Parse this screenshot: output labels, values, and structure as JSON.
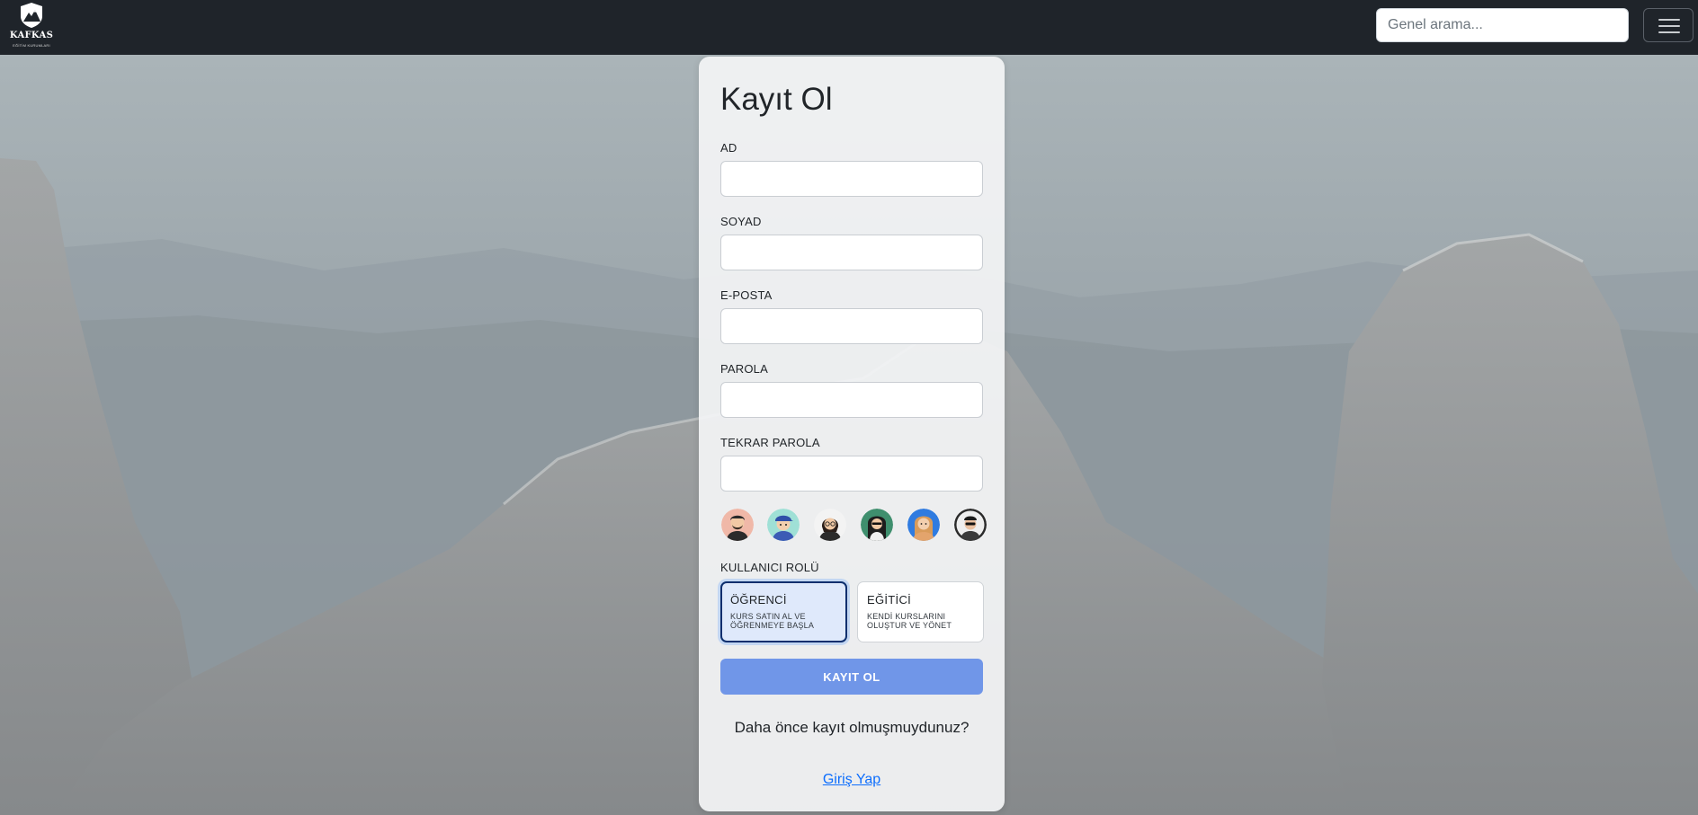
{
  "navbar": {
    "brand_name": "KAFKAS",
    "brand_subtitle": "EĞİTİM KURUMLARI",
    "search_placeholder": "Genel arama..."
  },
  "form": {
    "title": "Kayıt Ol",
    "fields": [
      {
        "label": "AD",
        "value": ""
      },
      {
        "label": "SOYAD",
        "value": ""
      },
      {
        "label": "E-POSTA",
        "value": ""
      },
      {
        "label": "PAROLA",
        "value": ""
      },
      {
        "label": "TEKRAR PAROLA",
        "value": ""
      }
    ],
    "avatars": [
      {
        "icon": "avatar-man-beard-icon",
        "bg": "#f0b8a8"
      },
      {
        "icon": "avatar-boy-cap-icon",
        "bg": "#9fe0d6"
      },
      {
        "icon": "avatar-woman-glasses-icon",
        "bg": "#f3f3f3"
      },
      {
        "icon": "avatar-woman-dark-hair-icon",
        "bg": "#3f8f6e"
      },
      {
        "icon": "avatar-woman-blonde-icon",
        "bg": "#2f7be0"
      },
      {
        "icon": "avatar-man-sunglasses-icon",
        "bg": "#2a2a2a"
      }
    ],
    "role_label": "KULLANICI ROLÜ",
    "roles": [
      {
        "title": "ÖĞRENCİ",
        "description": "KURS SATIN AL VE ÖĞRENMEYE BAŞLA",
        "selected": true
      },
      {
        "title": "EĞİTİCİ",
        "description": "KENDİ KURSLARINI OLUŞTUR VE YÖNET",
        "selected": false
      }
    ],
    "submit_label": "KAYIT OL",
    "login_prompt": "Daha önce kayıt olmuşmuydunuz?",
    "login_link": "Giriş Yap"
  },
  "colors": {
    "navbar_bg": "#1f242a",
    "submit_bg": "#7096e8",
    "link": "#0d6efd",
    "selected_role_bg": "#dfe9fb"
  }
}
